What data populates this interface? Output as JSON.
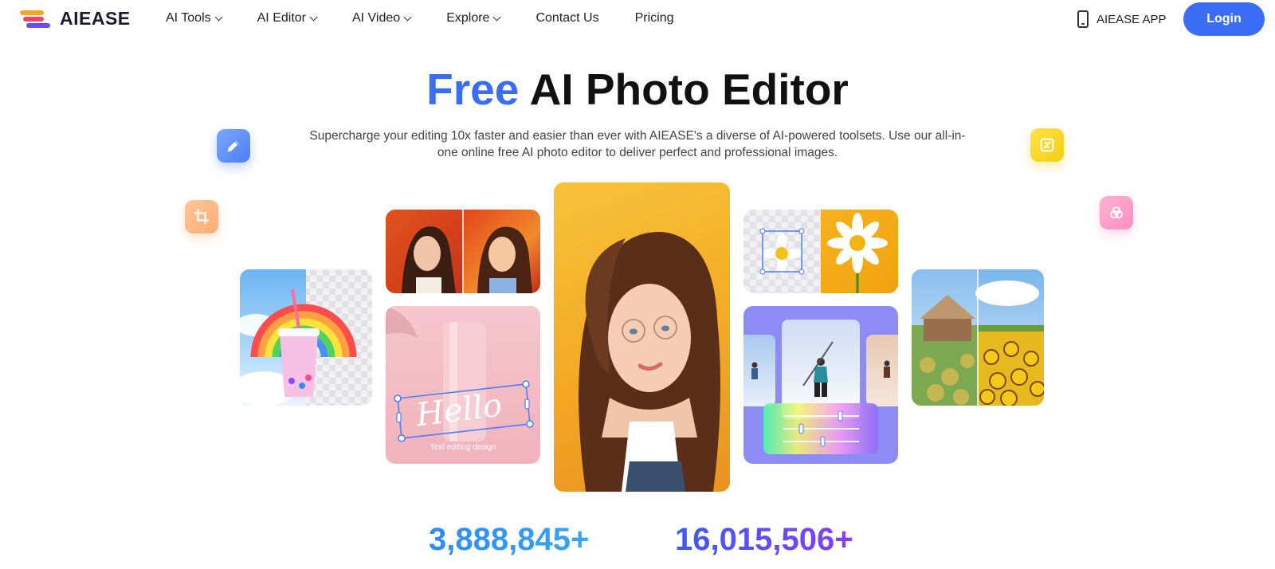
{
  "brand": {
    "name": "AIEASE"
  },
  "nav": {
    "items": [
      {
        "label": "AI Tools",
        "dropdown": true
      },
      {
        "label": "AI Editor",
        "dropdown": true
      },
      {
        "label": "AI Video",
        "dropdown": true
      },
      {
        "label": "Explore",
        "dropdown": true
      },
      {
        "label": "Contact Us",
        "dropdown": false
      },
      {
        "label": "Pricing",
        "dropdown": false
      }
    ],
    "app_label": "AIEASE APP",
    "login_label": "Login"
  },
  "hero": {
    "title_accent": "Free",
    "title_rest": "AI Photo Editor",
    "subtitle": "Supercharge your editing 10x faster and easier than ever with AIEASE's a diverse of AI-powered toolsets. Use our all-in-one online free AI photo editor to deliver perfect and professional images."
  },
  "showcase": {
    "text_card_word": "Hello",
    "text_card_caption": "Text editing design"
  },
  "floating_icons": [
    "pencil-icon",
    "crop-icon",
    "edit-square-icon",
    "filter-circles-icon"
  ],
  "stats": [
    {
      "value": "3,888,845+"
    },
    {
      "value": "16,015,506+"
    }
  ],
  "colors": {
    "accent": "#3b6cf6",
    "login_bg": "#3b6cf6"
  }
}
